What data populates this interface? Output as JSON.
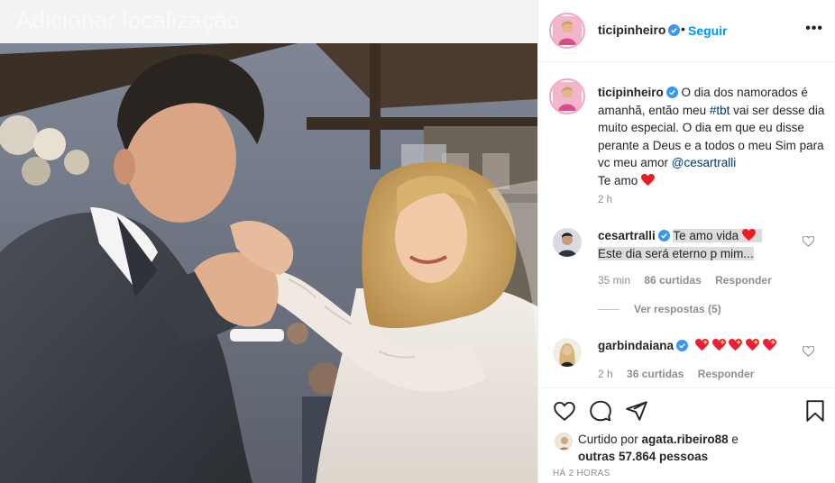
{
  "photo": {
    "location_overlay": "Adicionar localização"
  },
  "header": {
    "username": "ticipinheiro",
    "dot": "•",
    "follow_label": "Seguir",
    "more_label": "•••"
  },
  "caption": {
    "username": "ticipinheiro",
    "text_1": "O dia dos namorados é amanhã, então meu ",
    "hashtag": "#tbt",
    "text_2": " vai ser desse dia muito especial. O dia em que eu disse perante a Deus e a todos o meu Sim para vc meu amor ",
    "mention": "@cesartralli",
    "text_3": "Te amo",
    "time": "2 h"
  },
  "comments": [
    {
      "username": "cesartralli",
      "text_1": "Te amo vida",
      "text_2": "Este dia será eterno p mim...",
      "time": "35 min",
      "likes": "86 curtidas",
      "reply_label": "Responder"
    },
    {
      "username": "garbindaiana",
      "time": "2 h",
      "likes": "36 curtidas",
      "reply_label": "Responder"
    }
  ],
  "view_replies_label": "Ver respostas (5)",
  "likes_summary": {
    "prefix": "Curtido por ",
    "user": "agata.ribeiro88",
    "middle": " e",
    "others": "outras 57.864 pessoas"
  },
  "timestamp": "HÁ 2 HORAS",
  "colors": {
    "accent": "#0095f6",
    "heart": "#ed1c24",
    "verified": "#3897f0"
  },
  "icons": [
    "verified-icon",
    "heart-icon",
    "comment-icon",
    "share-icon",
    "bookmark-icon",
    "more-icon"
  ]
}
